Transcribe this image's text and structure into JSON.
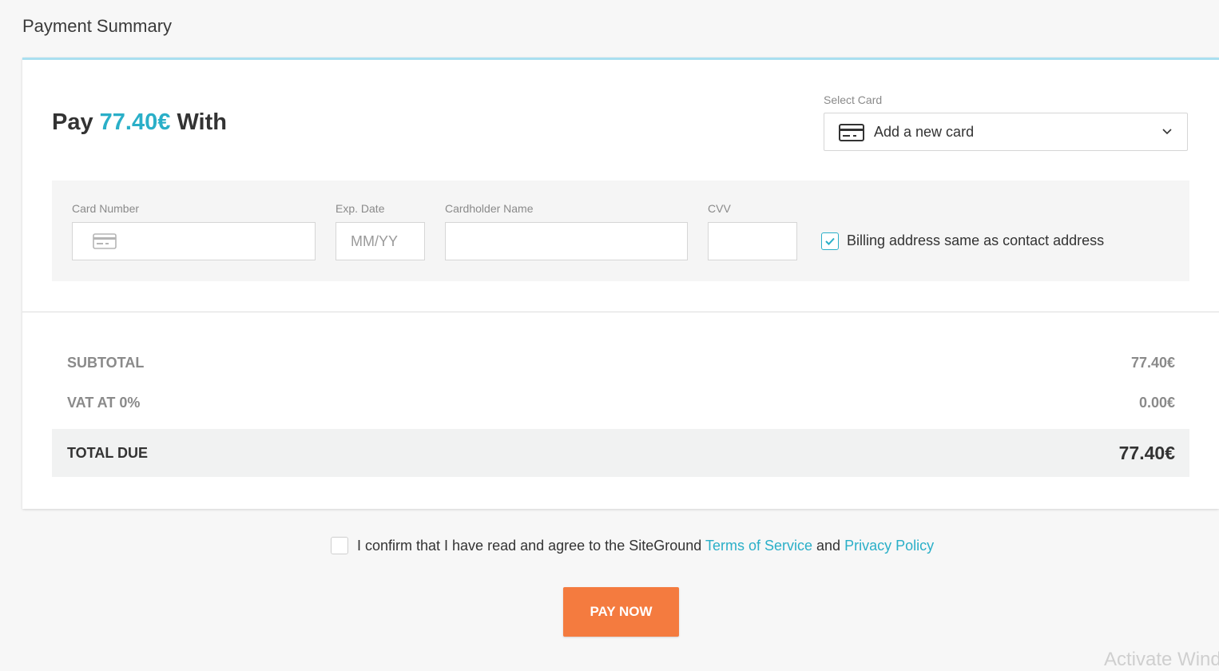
{
  "page": {
    "title": "Payment Summary"
  },
  "payment": {
    "heading_prefix": "Pay",
    "amount": "77.40€",
    "heading_suffix": "With"
  },
  "select_card": {
    "label": "Select Card",
    "value": "Add a new card",
    "icon": "credit-card-icon"
  },
  "card_form": {
    "card_number_label": "Card Number",
    "card_number_value": "",
    "exp_date_label": "Exp. Date",
    "exp_date_placeholder": "MM/YY",
    "cardholder_label": "Cardholder Name",
    "cardholder_value": "",
    "cvv_label": "CVV",
    "cvv_value": "",
    "billing_same_checked": true,
    "billing_same_label": "Billing address same as contact address"
  },
  "summary": {
    "subtotal_label": "SUBTOTAL",
    "subtotal_value": "77.40€",
    "vat_label": "VAT AT 0%",
    "vat_value": "0.00€",
    "total_label": "TOTAL DUE",
    "total_value": "77.40€"
  },
  "confirm": {
    "checked": false,
    "text_prefix": "I confirm that I have read and agree to the SiteGround",
    "terms_link": "Terms of Service",
    "text_and": "and",
    "privacy_link": "Privacy Policy"
  },
  "actions": {
    "pay_now_label": "PAY NOW"
  },
  "watermark": {
    "text": "Activate Windows"
  },
  "colors": {
    "accent": "#2aafc8",
    "button": "#f47b3f",
    "panel_border_top": "#a9dff0"
  }
}
